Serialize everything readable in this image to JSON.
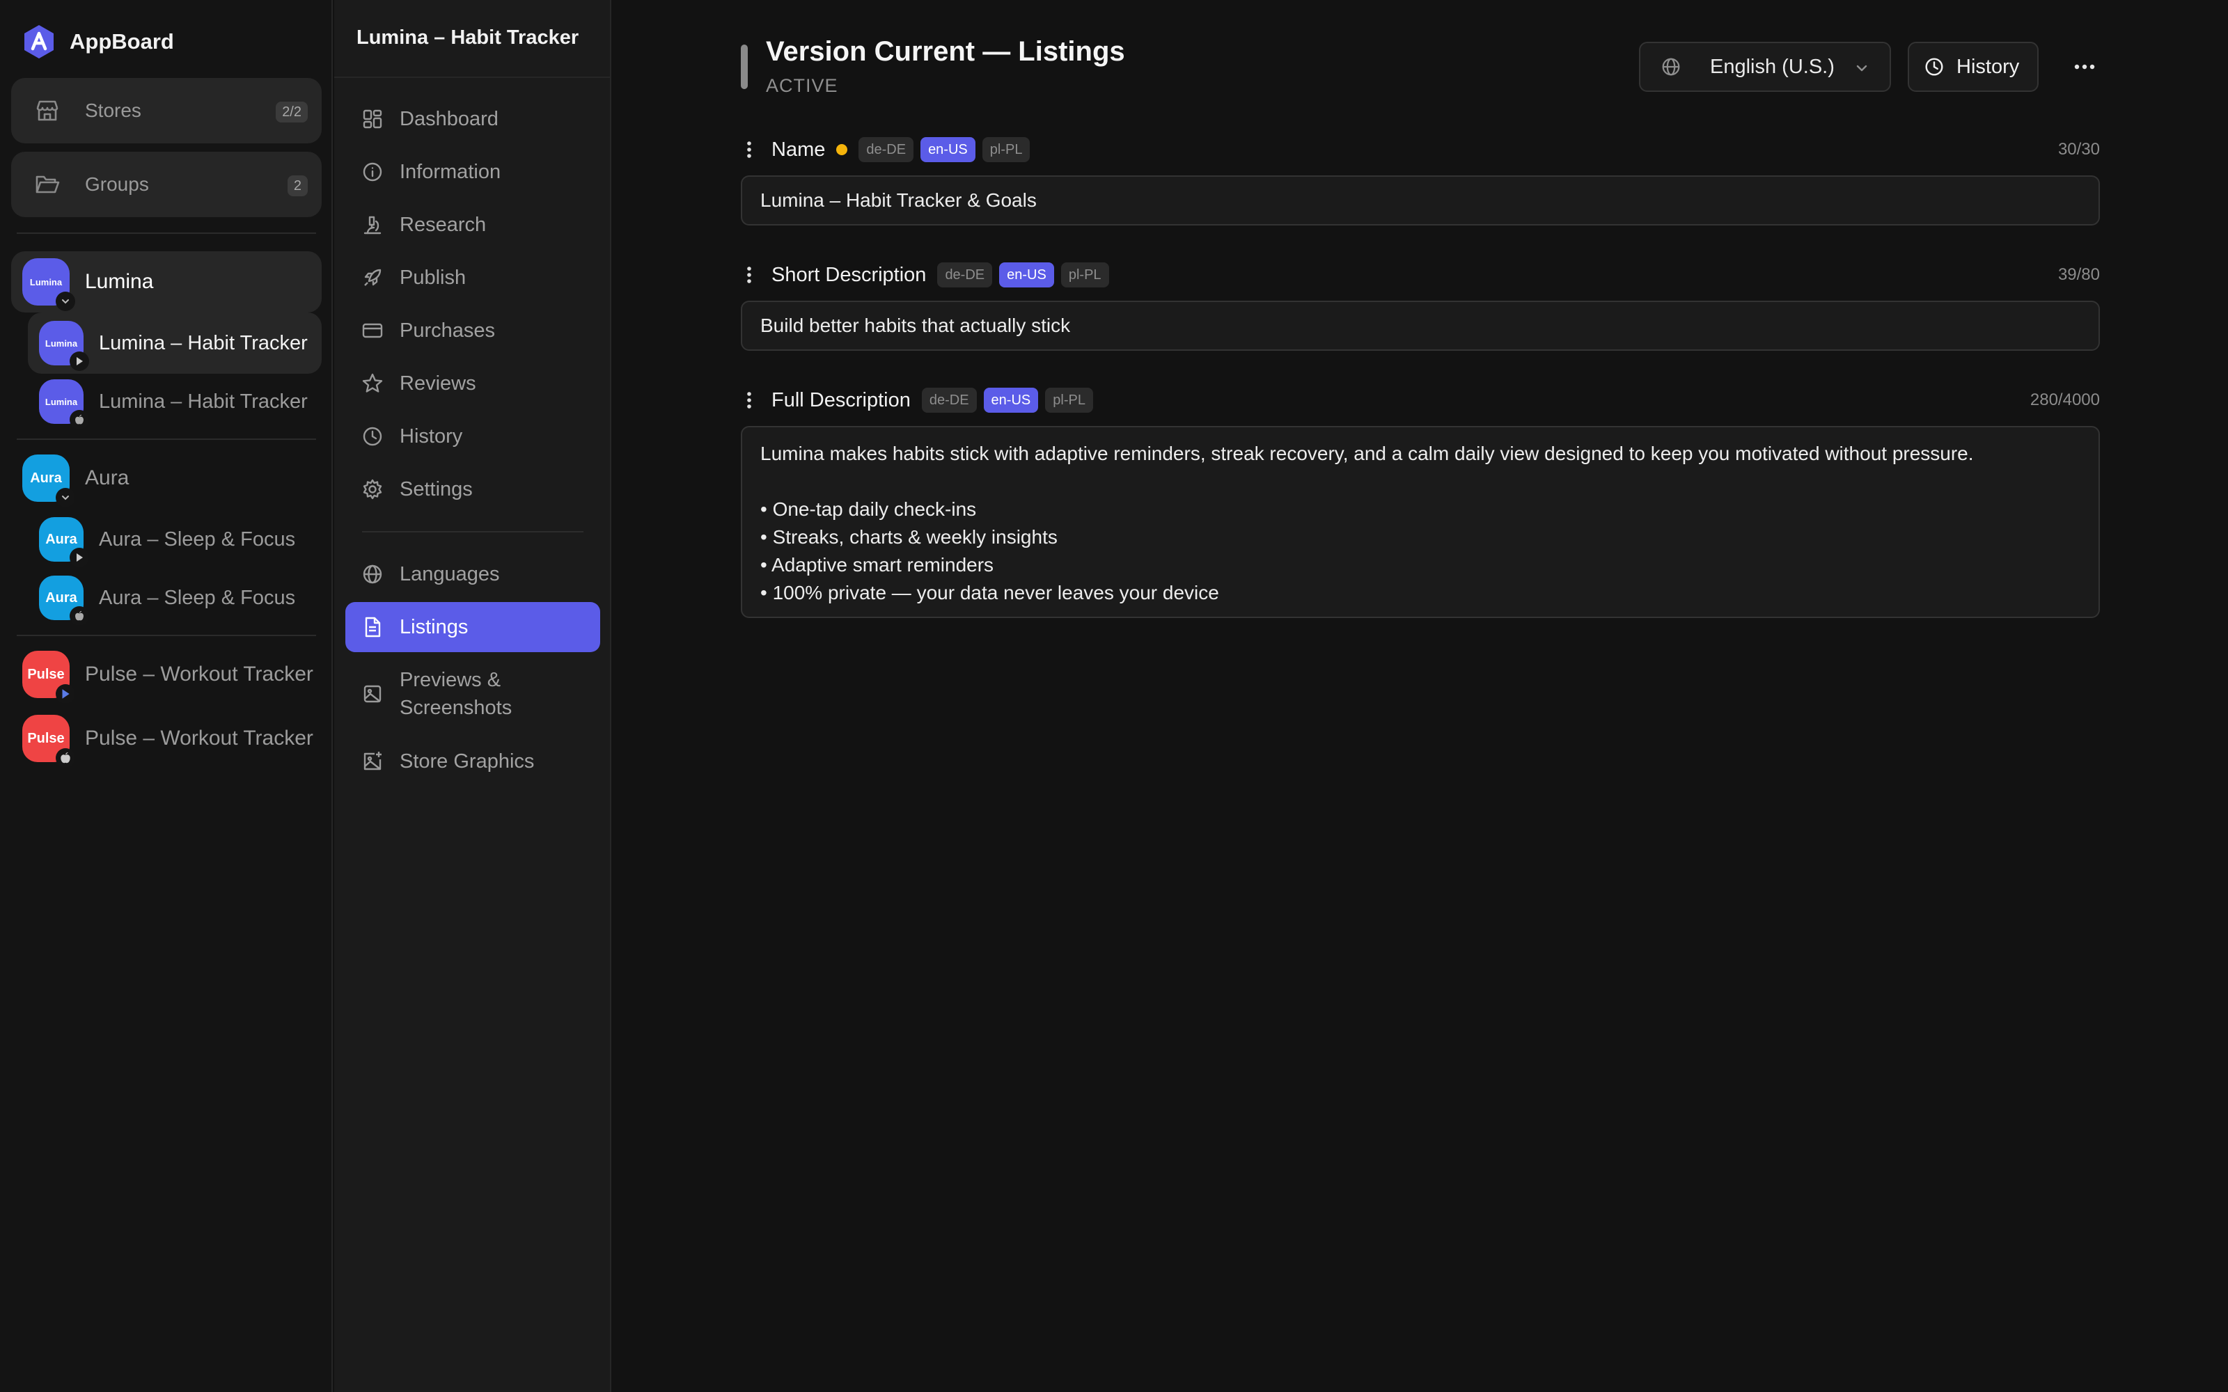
{
  "brand": {
    "name": "AppBoard"
  },
  "sidebar": {
    "tiles": [
      {
        "label": "Stores",
        "count": "2/2",
        "icon": "store-icon"
      },
      {
        "label": "Groups",
        "count": "2",
        "icon": "folder-icon"
      }
    ],
    "apps": [
      {
        "name": "Lumina",
        "avatar_text": "Lumina",
        "color": "#5b5ce8",
        "platform": "chevron-down",
        "selected": true
      },
      {
        "name": "Lumina – Habit Tracker",
        "avatar_text": "Lumina",
        "color": "#5b5ce8",
        "platform": "google-play",
        "selected": true
      },
      {
        "name": "Lumina – Habit Tracker",
        "avatar_text": "Lumina",
        "color": "#5b5ce8",
        "platform": "apple"
      },
      {
        "name": "Aura",
        "avatar_text": "Aura",
        "color": "#139fe0",
        "platform": "chevron-down"
      },
      {
        "name": "Aura – Sleep & Focus",
        "avatar_text": "Aura",
        "color": "#139fe0",
        "platform": "google-play"
      },
      {
        "name": "Aura – Sleep & Focus",
        "avatar_text": "Aura",
        "color": "#139fe0",
        "platform": "apple"
      },
      {
        "name": "Pulse – Workout Tracker",
        "avatar_text": "Pulse",
        "color": "#ef4444",
        "platform": "google-play"
      },
      {
        "name": "Pulse – Workout Tracker",
        "avatar_text": "Pulse",
        "color": "#ef4444",
        "platform": "apple"
      }
    ]
  },
  "subnav": {
    "title": "Lumina – Habit Tracker",
    "items": [
      {
        "label": "Dashboard",
        "icon": "dashboard-icon"
      },
      {
        "label": "Information",
        "icon": "info-icon"
      },
      {
        "label": "Research",
        "icon": "microscope-icon"
      },
      {
        "label": "Publish",
        "icon": "rocket-icon"
      },
      {
        "label": "Purchases",
        "icon": "credit-card-icon"
      },
      {
        "label": "Reviews",
        "icon": "star-icon"
      },
      {
        "label": "History",
        "icon": "clock-icon"
      },
      {
        "label": "Settings",
        "icon": "gear-icon"
      },
      {
        "label": "Languages",
        "icon": "globe-icon"
      },
      {
        "label": "Listings",
        "icon": "document-icon",
        "active": true
      },
      {
        "label": "Previews & Screenshots",
        "icon": "image-icon"
      },
      {
        "label": "Store Graphics",
        "icon": "image-plus-icon"
      }
    ]
  },
  "main": {
    "title": "Version Current — Listings",
    "status": "ACTIVE",
    "language": "English (U.S.)",
    "history_label": "History",
    "fields": [
      {
        "label": "Name",
        "modified": true,
        "locales": [
          "de-DE",
          "en-US",
          "pl-PL"
        ],
        "active_locale": "en-US",
        "count": "30/30",
        "value": "Lumina – Habit Tracker & Goals"
      },
      {
        "label": "Short Description",
        "locales": [
          "de-DE",
          "en-US",
          "pl-PL"
        ],
        "active_locale": "en-US",
        "count": "39/80",
        "value": "Build better habits that actually stick"
      },
      {
        "label": "Full Description",
        "locales": [
          "de-DE",
          "en-US",
          "pl-PL"
        ],
        "active_locale": "en-US",
        "count": "280/4000",
        "lines": [
          "Lumina makes habits stick with adaptive reminders, streak recovery, and a calm daily view designed to keep you motivated without pressure.",
          "",
          "• One-tap daily check-ins",
          "• Streaks, charts & weekly insights",
          "• Adaptive smart reminders",
          "• 100% private — your data never leaves your device"
        ]
      }
    ]
  },
  "colors": {
    "accent": "#5b5ce8",
    "warning": "#f5b40b",
    "background": "#121212"
  }
}
